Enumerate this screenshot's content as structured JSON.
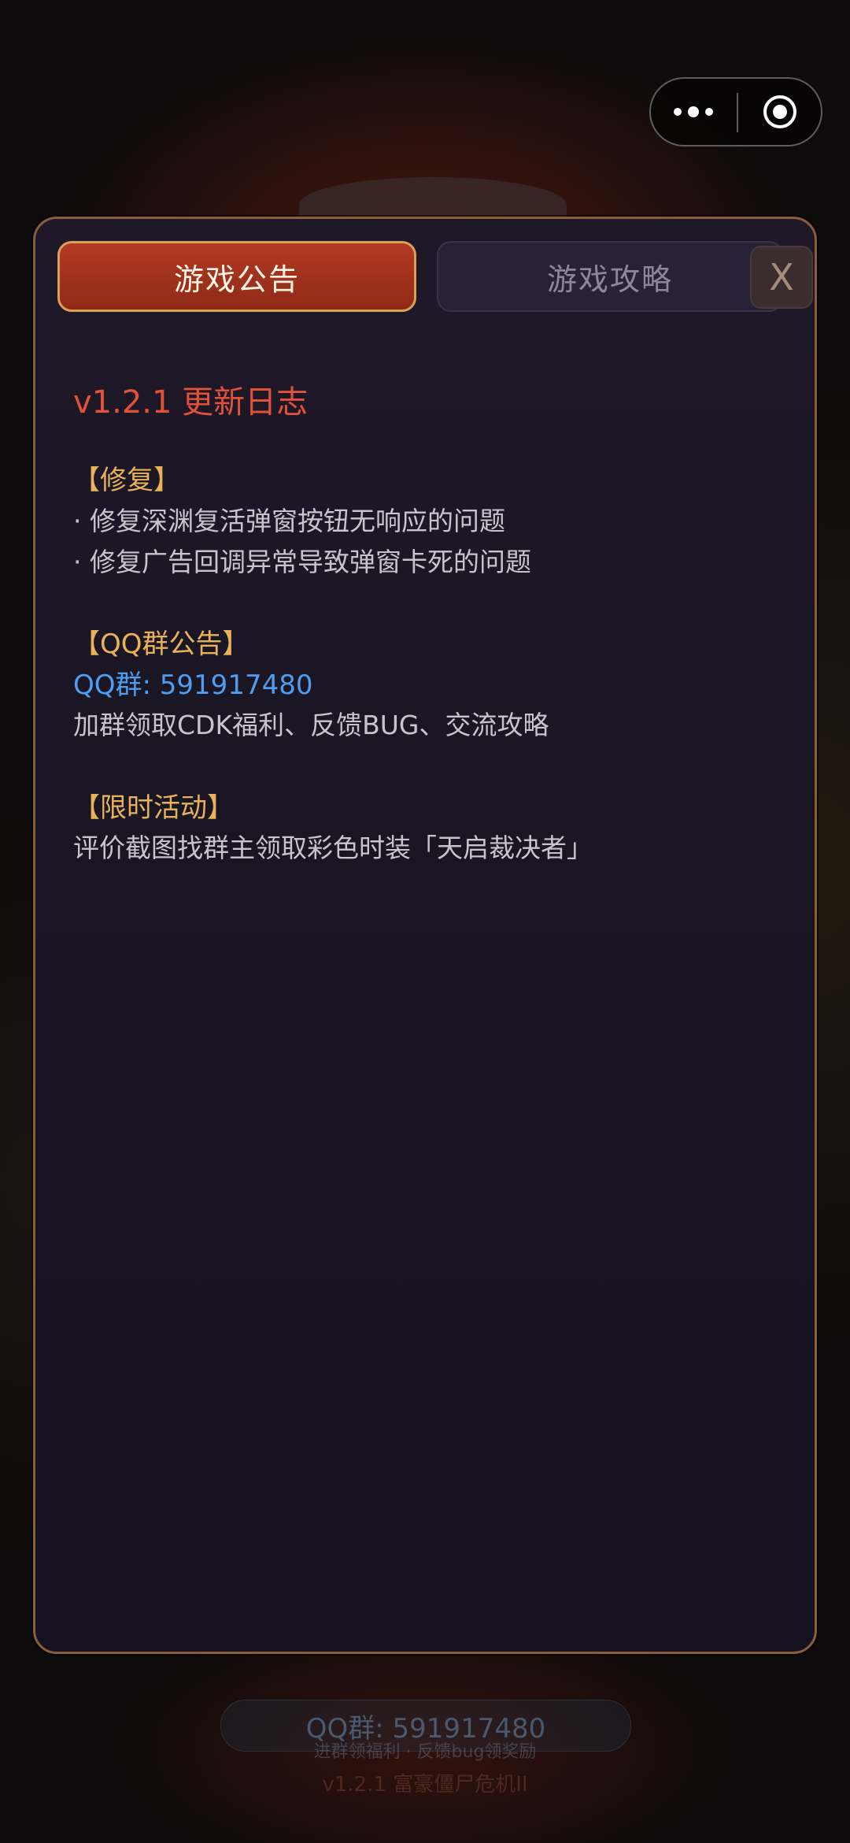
{
  "capsule": {
    "more_icon": "more-dots-icon",
    "close_icon": "target-close-icon"
  },
  "modal": {
    "tabs": [
      {
        "label": "游戏公告",
        "active": true
      },
      {
        "label": "游戏攻略",
        "active": false
      }
    ],
    "close_label": "X",
    "version_title": "v1.2.1 更新日志",
    "sections": {
      "fix": {
        "heading": "【修复】",
        "items": [
          "· 修复深渊复活弹窗按钮无响应的问题",
          "· 修复广告回调异常导致弹窗卡死的问题"
        ]
      },
      "qq": {
        "heading": "【QQ群公告】",
        "group": "QQ群: 591917480",
        "desc": "加群领取CDK福利、反馈BUG、交流攻略"
      },
      "event": {
        "heading": "【限时活动】",
        "desc": "评价截图找群主领取彩色时装「天启裁决者」"
      }
    }
  },
  "background": {
    "qq_pill": "QQ群: 591917480",
    "sub": "进群领福利 · 反馈bug领奖励",
    "version": "v1.2.1 富豪僵尸危机II"
  },
  "colors": {
    "accent_red": "#e2513a",
    "heading_gold": "#e7b25a",
    "link_blue": "#4f9df0",
    "tab_active": "#b23a22"
  }
}
